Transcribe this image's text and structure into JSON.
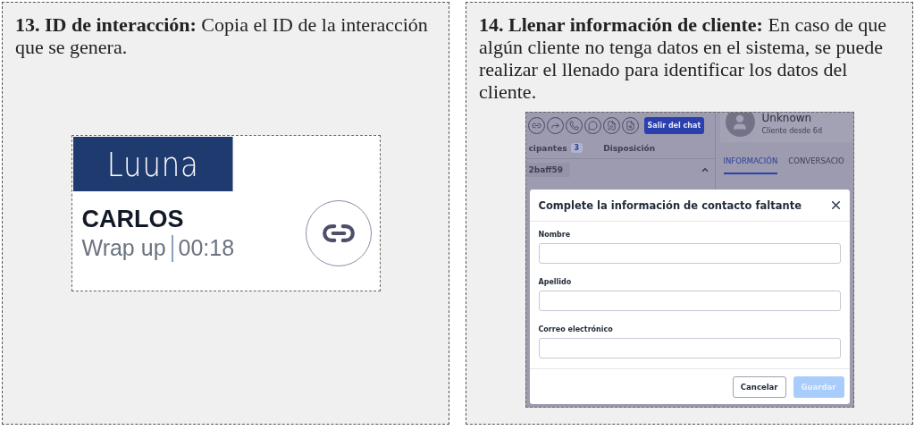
{
  "step_13": {
    "text": "**13. ID de interacción:** Copia el ID de la interacción que se genera.",
    "card": {
      "logo": "Luuna",
      "agent": "CARLOS",
      "status": "Wrap up",
      "timer": "00:18"
    }
  },
  "step_14": {
    "text": "**14. Llenar información de cliente:** En caso de que algún cliente no tenga datos en el sistema, se puede realizar el llenado para identificar los datos del cliente.",
    "app": {
      "exit_button": "Salir del chat",
      "left_tabs": [
        {
          "label": "cipantes",
          "badge": "3",
          "selected": false
        },
        {
          "label": "Disposición",
          "selected": false
        }
      ],
      "row_id": "2baff59",
      "contact_name": "Unknown",
      "contact_since": "Cliente desde 6d",
      "right_tabs": [
        {
          "label": "INFORMACIÓN",
          "selected": true
        },
        {
          "label": "CONVERSACIO",
          "selected": false
        }
      ]
    },
    "modal": {
      "title": "Complete la información de contacto faltante",
      "fields": [
        {
          "label": "Nombre"
        },
        {
          "label": "Apellido"
        },
        {
          "label": "Correo electrónico"
        }
      ],
      "buttons": [
        {
          "label": "Cancelar",
          "kind": "secondary",
          "disabled": false
        },
        {
          "label": "Guardar",
          "kind": "primary",
          "disabled": true
        }
      ]
    }
  }
}
